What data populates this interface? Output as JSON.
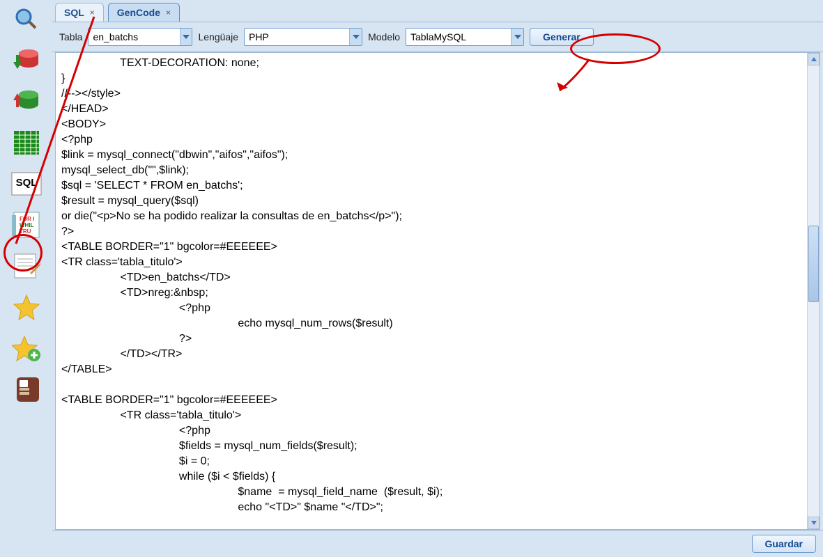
{
  "sidebar": {
    "icons": [
      "search-icon",
      "db-up-icon",
      "db-down-icon",
      "grid-icon",
      "sql-icon",
      "code-icon",
      "edit-page-icon",
      "star-icon",
      "star-add-icon",
      "address-book-icon"
    ]
  },
  "tabs": [
    {
      "label": "SQL",
      "active": false
    },
    {
      "label": "GenCode",
      "active": true
    }
  ],
  "toolbar": {
    "tabla_label": "Tabla",
    "tabla_value": "en_batchs",
    "lenguaje_label": "Lengüaje",
    "lenguaje_value": "PHP",
    "modelo_label": "Modelo",
    "modelo_value": "TablaMySQL",
    "generar_label": "Generar"
  },
  "code": "                   TEXT-DECORATION: none;\n}\n//--></style>\n</HEAD>\n<BODY>\n<?php\n$link = mysql_connect(\"dbwin\",\"aifos\",\"aifos\");\nmysql_select_db(\"\",$link);\n$sql = 'SELECT * FROM en_batchs';\n$result = mysql_query($sql)\nor die(\"<p>No se ha podido realizar la consultas de en_batchs</p>\");\n?>\n<TABLE BORDER=\"1\" bgcolor=#EEEEEE>\n<TR class='tabla_titulo'>\n                   <TD>en_batchs</TD>\n                   <TD>nreg:&nbsp;\n                                      <?php\n                                                         echo mysql_num_rows($result)\n                                      ?>\n                   </TD></TR>\n</TABLE>\n\n<TABLE BORDER=\"1\" bgcolor=#EEEEEE>\n                   <TR class='tabla_titulo'>\n                                      <?php\n                                      $fields = mysql_num_fields($result);\n                                      $i = 0;\n                                      while ($i < $fields) {\n                                                         $name  = mysql_field_name  ($result, $i);\n                                                         echo \"<TD>\" $name \"</TD>\";",
  "footer": {
    "guardar_label": "Guardar"
  }
}
